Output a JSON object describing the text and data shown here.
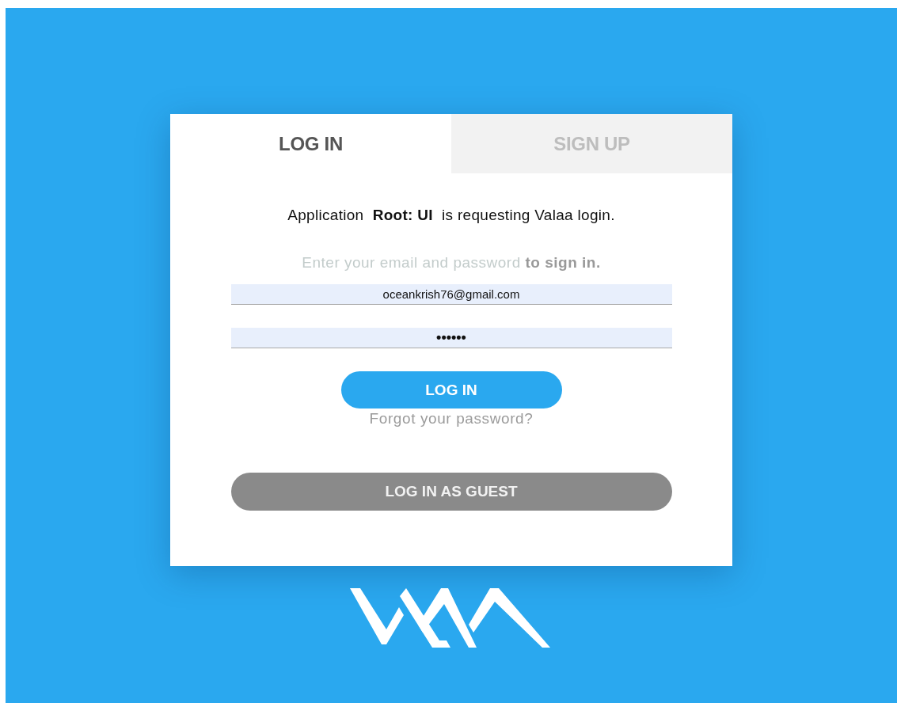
{
  "tabs": [
    {
      "label": "LOG IN",
      "selected": true
    },
    {
      "label": "SIGN UP",
      "selected": false
    }
  ],
  "request_message": "Application  **Root: UI**  is requesting Valaa login.",
  "instructions": "Enter your email and password **to sign in.**",
  "fields": [
    {
      "kind": "email",
      "value": "oceankrish76@gmail.com"
    },
    {
      "kind": "password",
      "value": "••••••"
    }
  ],
  "login_button": "LOG IN",
  "forgot_link": "Forgot your password?",
  "guest_button": "LOG IN AS GUEST"
}
